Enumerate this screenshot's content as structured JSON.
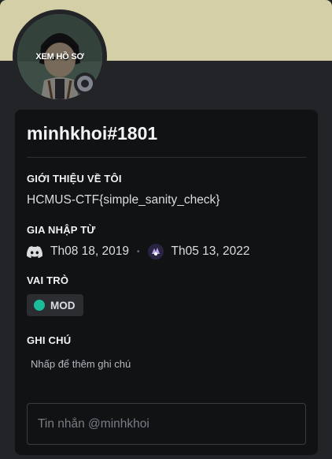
{
  "avatar": {
    "hover_label": "XEM HỒ SƠ",
    "status": "offline",
    "status_color": "#80848e"
  },
  "banner": {
    "color": "#d4cfa6"
  },
  "profile": {
    "username": "minhkhoi#1801"
  },
  "about": {
    "title": "GIỚI THIỆU VỀ TÔI",
    "text": "HCMUS-CTF{simple_sanity_check}"
  },
  "member_since": {
    "title": "GIA NHẬP TỪ",
    "discord_date": "Th08 18, 2019",
    "server_date": "Th05 13, 2022",
    "separator": "•"
  },
  "roles": {
    "title": "VAI TRÒ",
    "items": [
      {
        "name": "MOD",
        "color": "#1abc9c"
      }
    ]
  },
  "note": {
    "title": "GHI CHÚ",
    "placeholder": "Nhấp để thêm ghi chú"
  },
  "message": {
    "placeholder": "Tin nhắn @minhkhoi"
  }
}
